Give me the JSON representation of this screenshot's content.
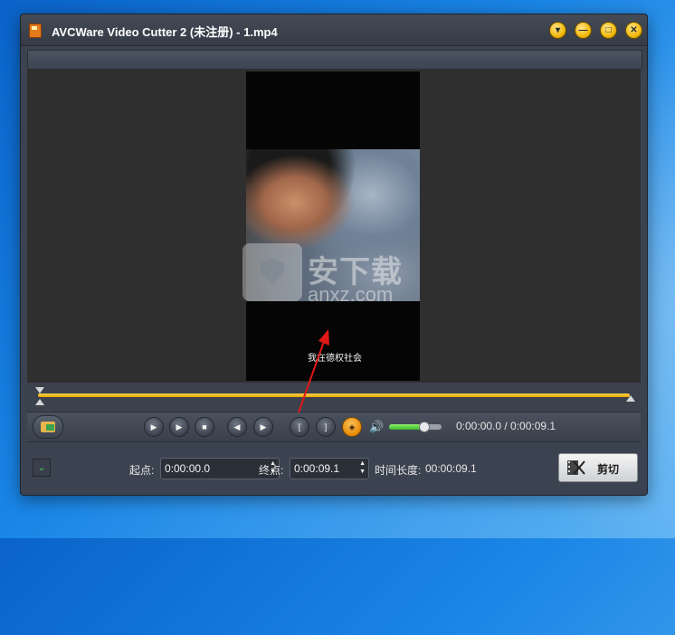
{
  "window": {
    "title": "AVCWare Video Cutter 2 (未注册) - 1.mp4",
    "title_color": "#ffffff"
  },
  "titlebar_buttons": [
    {
      "name": "menu-dropdown-button",
      "glyph": "▾"
    },
    {
      "name": "minimize-button",
      "glyph": "—"
    },
    {
      "name": "maximize-button",
      "glyph": "□"
    },
    {
      "name": "close-button",
      "glyph": "✕"
    }
  ],
  "video": {
    "subtitle": "我在德权社会",
    "watermark_main": "安下载",
    "watermark_sub": "anxz.com"
  },
  "timeline": {
    "accent": "#f0a500"
  },
  "controls": {
    "buttons": [
      {
        "name": "play-button",
        "glyph": "▶",
        "style": "normal"
      },
      {
        "name": "play-segment-button",
        "glyph": "▶",
        "style": "normal"
      },
      {
        "name": "stop-button",
        "glyph": "■",
        "style": "normal"
      },
      {
        "name": "previous-frame-button",
        "glyph": "◀",
        "style": "normal"
      },
      {
        "name": "next-frame-button",
        "glyph": "▶",
        "style": "normal"
      },
      {
        "name": "set-start-button",
        "glyph": "[",
        "style": "normal"
      },
      {
        "name": "set-end-button",
        "glyph": "]",
        "style": "normal"
      },
      {
        "name": "snapshot-button",
        "glyph": "◈",
        "style": "orange"
      }
    ],
    "speaker_icon": "🔊",
    "volume_level": 0.65,
    "time_readout": "0:00:00.0 / 0:00:09.1"
  },
  "bottom": {
    "start_label": "起点:",
    "start_value": "0:00:00.0",
    "end_label": "终点:",
    "end_value": "0:00:09.1",
    "duration_label": "时间长度:",
    "duration_value": "00:00:09.1",
    "cut_button_label": "剪切",
    "expand_glyph": "⌄"
  }
}
